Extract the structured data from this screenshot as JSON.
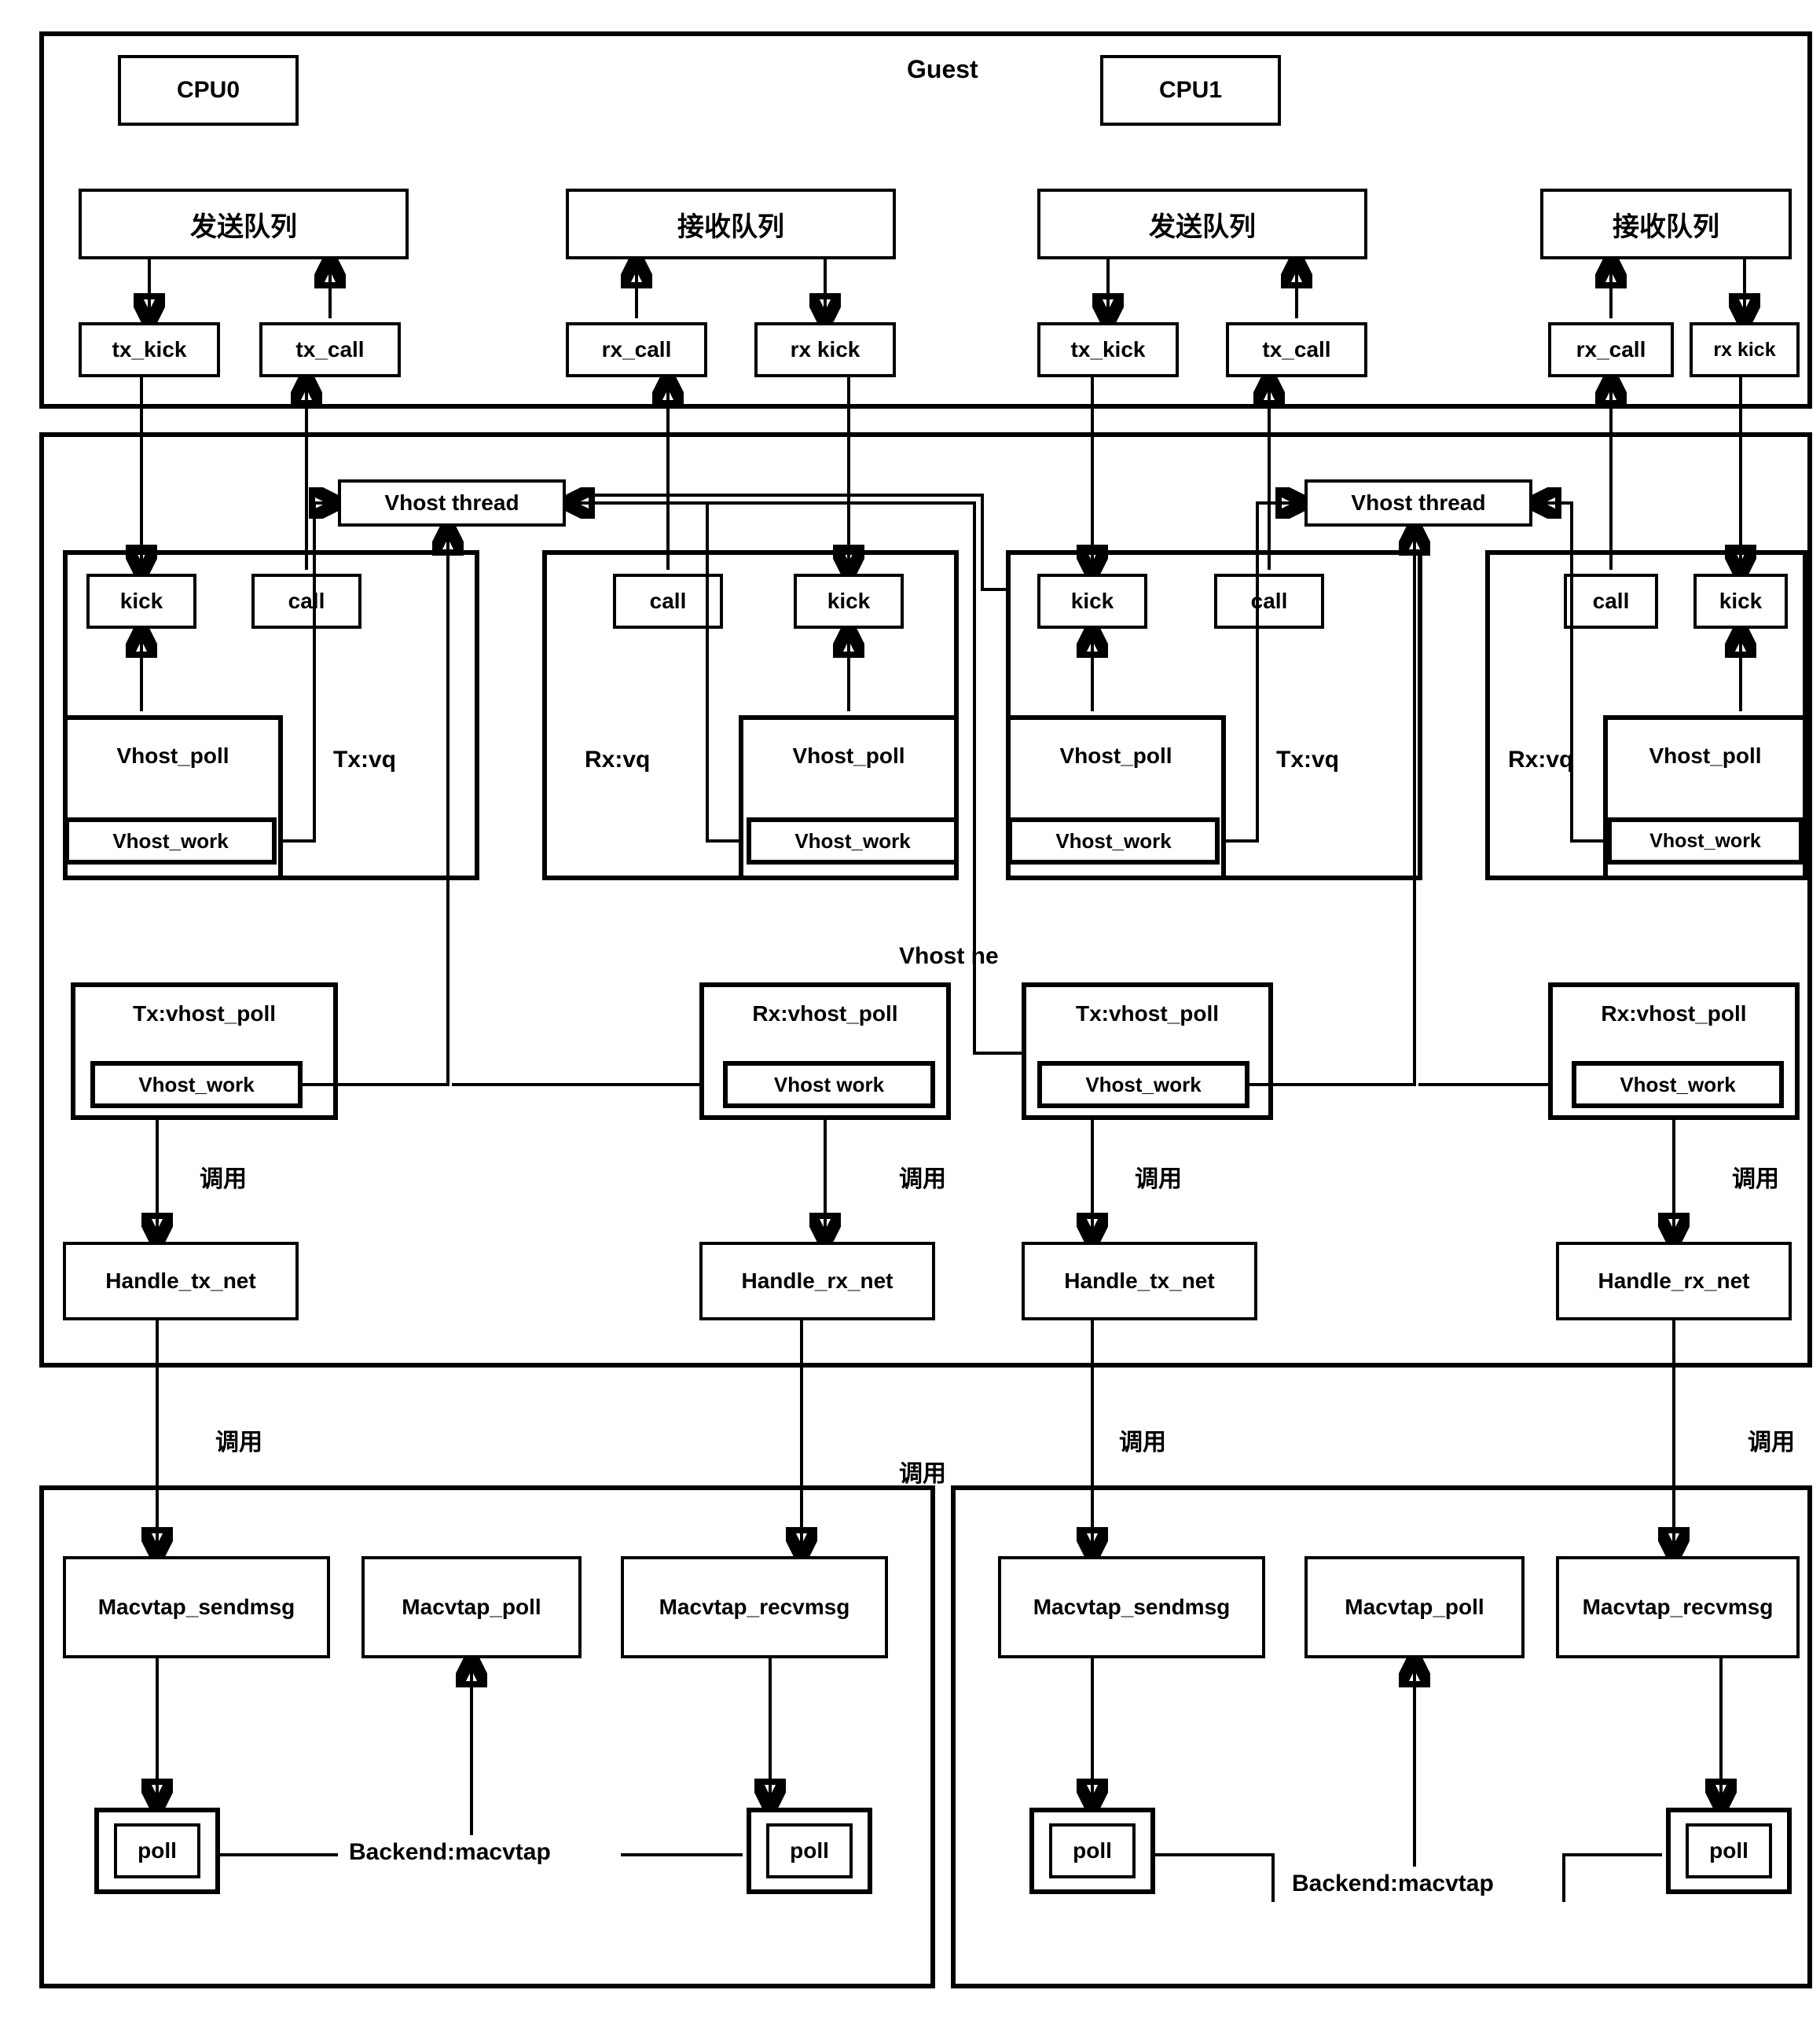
{
  "guest": {
    "title": "Guest",
    "cpu0": "CPU0",
    "cpu1": "CPU1",
    "send_queue_a": "发送队列",
    "recv_queue_a": "接收队列",
    "send_queue_b": "发送队列",
    "recv_queue_b": "接收队列",
    "tx_kick_a": "tx_kick",
    "tx_call_a": "tx_call",
    "rx_call_a": "rx_call",
    "rx_kick_a": "rx  kick",
    "tx_kick_b": "tx_kick",
    "tx_call_b": "tx_call",
    "rx_call_b": "rx_call",
    "rx_kick_b": "rx  kick"
  },
  "vhost": {
    "thread_a": "Vhost thread",
    "thread_b": "Vhost thread",
    "section_label": "Vhost  ne",
    "tx_vq_a": {
      "kick": "kick",
      "call": "call",
      "poll": "Vhost_poll",
      "work": "Vhost_work",
      "label": "Tx:vq"
    },
    "rx_vq_a": {
      "call": "call",
      "kick": "kick",
      "poll": "Vhost_poll",
      "work": "Vhost_work",
      "label": "Rx:vq"
    },
    "tx_vq_b": {
      "kick": "kick",
      "call": "call",
      "poll": "Vhost_poll",
      "work": "Vhost_work",
      "label": "Tx:vq"
    },
    "rx_vq_b": {
      "call": "call",
      "kick": "kick",
      "poll": "Vhost_poll",
      "work": "Vhost_work",
      "label": "Rx:vq"
    },
    "tx_poll_a": {
      "title": "Tx:vhost_poll",
      "work": "Vhost_work"
    },
    "rx_poll_a": {
      "title": "Rx:vhost_poll",
      "work": "Vhost work"
    },
    "tx_poll_b": {
      "title": "Tx:vhost_poll",
      "work": "Vhost_work"
    },
    "rx_poll_b": {
      "title": "Rx:vhost_poll",
      "work": "Vhost_work"
    },
    "call_label_a1": "调用",
    "call_label_a2": "调用",
    "call_label_b1": "调用",
    "call_label_b2": "调用",
    "call_label_c1": "调用",
    "call_label_c2": "调用",
    "call_label_c3": "调用",
    "call_label_c4": "调用",
    "handle_tx_a": "Handle_tx_net",
    "handle_rx_a": "Handle_rx_net",
    "handle_tx_b": "Handle_tx_net",
    "handle_rx_b": "Handle_rx_net"
  },
  "macvtap": {
    "sendmsg_a": "Macvtap_sendmsg",
    "poll_a": "Macvtap_poll",
    "recvmsg_a": "Macvtap_recvmsg",
    "sendmsg_b": "Macvtap_sendmsg",
    "poll_b": "Macvtap_poll",
    "recvmsg_b": "Macvtap_recvmsg",
    "poll_box_a1": "poll",
    "poll_box_a2": "poll",
    "poll_box_b1": "poll",
    "poll_box_b2": "poll",
    "backend_a": "Backend:macvtap",
    "backend_b": "Backend:macvtap"
  }
}
